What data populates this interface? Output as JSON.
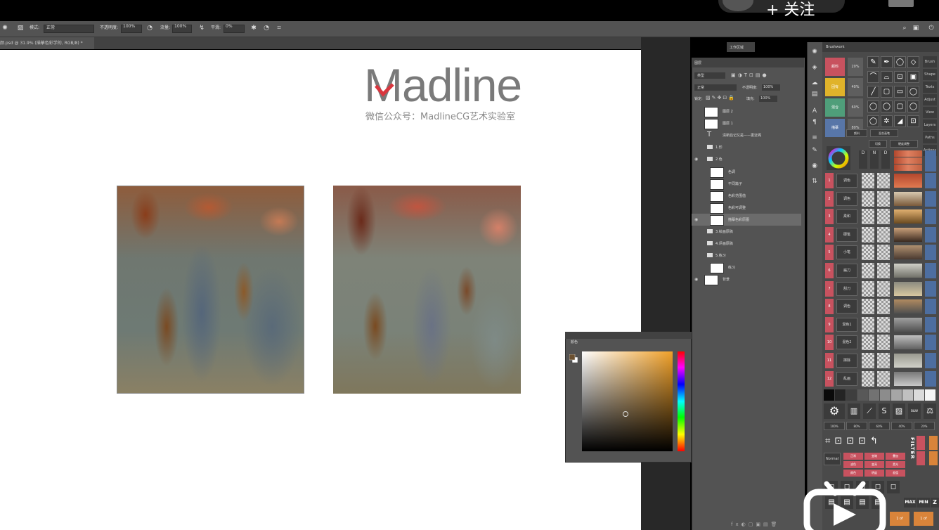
{
  "video_overlay": {
    "follow_label": "+ 关注"
  },
  "optbar": {
    "mode_label": "模式:",
    "mode_value": "正常",
    "opacity_label": "不透明度:",
    "opacity_value": "100%",
    "flow_label": "流量:",
    "flow_value": "100%",
    "smooth_label": "平滑:",
    "smooth_value": "0%"
  },
  "document": {
    "tab_label": "颜.psd @ 31.9% (描摹色彩学的, RGB/8) *"
  },
  "canvas": {
    "logo_prefix": "M",
    "logo_rest": "adline",
    "subtitle": "微信公众号：MadlineCG艺术实验室"
  },
  "color_panel": {
    "title": "颜色"
  },
  "layers_panel": {
    "title": "图层",
    "kind_label": "类型",
    "blend_mode": "正常",
    "opacity_label": "不透明度:",
    "opacity_value": "100%",
    "lock_label": "锁定:",
    "fill_label": "填充:",
    "fill_value": "100%",
    "layers": [
      {
        "name": "图层 2",
        "type": "pixel",
        "visible": false
      },
      {
        "name": "图层 1",
        "type": "pixel",
        "visible": false
      },
      {
        "name": "清新后记又是——更近阁",
        "type": "text",
        "visible": false
      },
      {
        "name": "1.形",
        "type": "group",
        "visible": false
      },
      {
        "name": "2.色",
        "type": "group",
        "visible": true
      },
      {
        "name": "色调",
        "type": "pixel",
        "visible": false
      },
      {
        "name": "不同篇子",
        "type": "pixel",
        "visible": false
      },
      {
        "name": "色彩范围值",
        "type": "pixel",
        "visible": false
      },
      {
        "name": "色彩可调整",
        "type": "pixel",
        "visible": false
      },
      {
        "name": "描摹色彩原图",
        "type": "pixel",
        "visible": true,
        "selected": true
      },
      {
        "name": "3.绘画原稿",
        "type": "group",
        "visible": false
      },
      {
        "name": "4.评画原稿",
        "type": "group",
        "visible": false
      },
      {
        "name": "5.练习",
        "type": "group",
        "visible": false
      },
      {
        "name": "练习",
        "type": "pixel",
        "visible": false
      },
      {
        "name": "背景",
        "type": "pixel",
        "visible": true
      }
    ]
  },
  "workspace_panel": {
    "tab_label": "工作区域"
  },
  "brush_panel": {
    "title": "Brushwork",
    "color_buttons": [
      {
        "label": "颜料",
        "color": "#c8525f",
        "pct": "20%"
      },
      {
        "label": "固有",
        "color": "#e0b32a",
        "pct": "40%"
      },
      {
        "label": "混合",
        "color": "#4f9e7a",
        "pct": "60%"
      },
      {
        "label": "描摹",
        "color": "#5876a8",
        "pct": "80%"
      }
    ],
    "tool_labels": [
      "颜料",
      "混合画笔",
      "切换",
      "硬度调整"
    ],
    "side_labels": [
      "Brush",
      "Shape",
      "Texts",
      "Adjust",
      "View",
      "Layers",
      "Paths",
      "Actions"
    ],
    "numbered": [
      "1",
      "2",
      "3",
      "4",
      "5",
      "6",
      "7",
      "8",
      "9",
      "10",
      "11",
      "12"
    ],
    "numbered_names": [
      "调色",
      "调色",
      "柔和",
      "硬笔",
      "小笔",
      "扁刀",
      "刮刀",
      "调色",
      "混色1",
      "混色2",
      "擦除",
      "乱画"
    ],
    "pct_row": [
      "100%",
      "80%",
      "60%",
      "40%",
      "20%"
    ],
    "filter_label": "FILTER",
    "normal_label": "Normal",
    "red_grid": [
      "正常",
      "变暗",
      "叠加",
      "滤色",
      "变亮",
      "柔光",
      "颜色",
      "明度",
      "差值"
    ],
    "max_label": "MAX",
    "min_label": "MIN",
    "z_label": "Z",
    "orange_labels": [
      "Z",
      "1 of",
      "1 of"
    ],
    "adjust_labels": [
      "S",
      "B&W"
    ]
  }
}
